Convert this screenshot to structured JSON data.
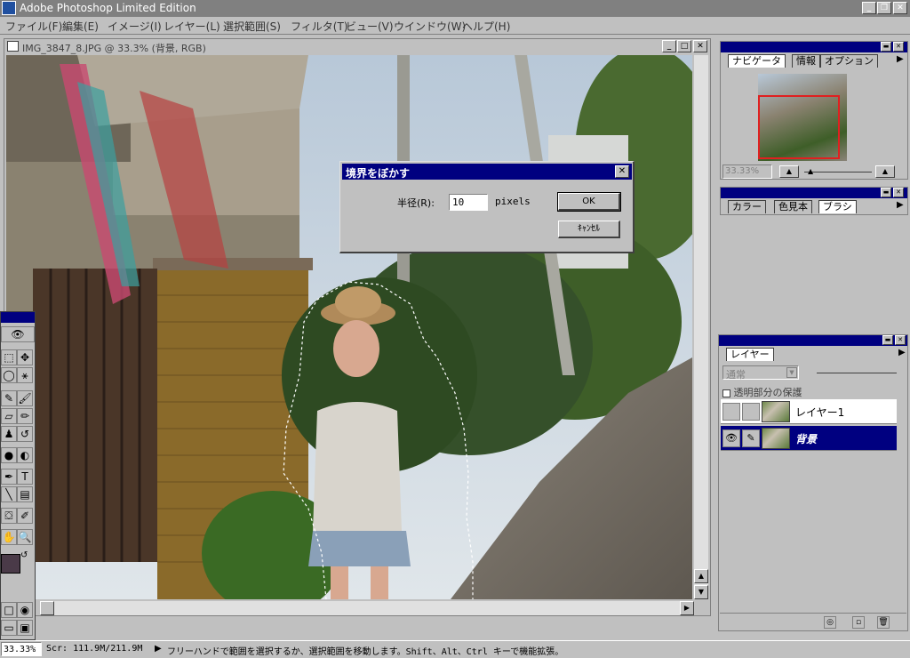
{
  "app": {
    "title": "Adobe Photoshop Limited Edition",
    "window_controls": [
      "_",
      "❐",
      "✕"
    ]
  },
  "menu": [
    "ファイル(F)",
    "編集(E)",
    "イメージ(I)",
    "レイヤー(L)",
    "選択範囲(S)",
    "フィルタ(T)",
    "ビュー(V)",
    "ウインドウ(W)",
    "ヘルプ(H)"
  ],
  "document": {
    "title": "IMG_3847_8.JPG @ 33.3% (背景, RGB)"
  },
  "dialog": {
    "title": "境界をぼかす",
    "radius_label": "半径(R):",
    "radius_value": "10",
    "unit": "pixels",
    "ok_label": "OK",
    "cancel_label": "ｷｬﾝｾﾙ"
  },
  "navigator": {
    "tabs": [
      "ナビゲータ",
      "情報",
      "オプション"
    ],
    "zoom": "33.33%"
  },
  "color_palette": {
    "tabs": [
      "カラー",
      "色見本",
      "ブラシ"
    ]
  },
  "layers_palette": {
    "tab": "レイヤー",
    "blend_mode": "通常",
    "preserve_transparency": "透明部分の保護",
    "layers": [
      {
        "name": "レイヤー1",
        "selected": false
      },
      {
        "name": "背景",
        "selected": true
      }
    ]
  },
  "status": {
    "zoom": "33.33%",
    "scratch": "Scr: 111.9M/211.9M",
    "arrow": "▶",
    "hint": "フリーハンドで範囲を選択するか、選択範囲を移動します。Shift、Alt、Ctrl キーで機能拡張。"
  },
  "colors": {
    "title_active": "#000080",
    "foreground_swatch": "#4a3a48",
    "background_swatch": "#ffffff",
    "selection_marquee": "#ffffff"
  },
  "icons": {
    "eye": "👁",
    "brush": "𝒷",
    "tools": [
      "eye-icon",
      "move-icon",
      "marquee-icon",
      "lasso-icon",
      "magic-wand-icon",
      "brush-icon",
      "pencil-icon",
      "stamp-icon",
      "history-brush-icon",
      "eraser-icon",
      "gradient-icon",
      "type-icon",
      "pen-icon",
      "dodge-icon",
      "eyedropper-icon",
      "hand-icon",
      "zoom-icon"
    ]
  }
}
